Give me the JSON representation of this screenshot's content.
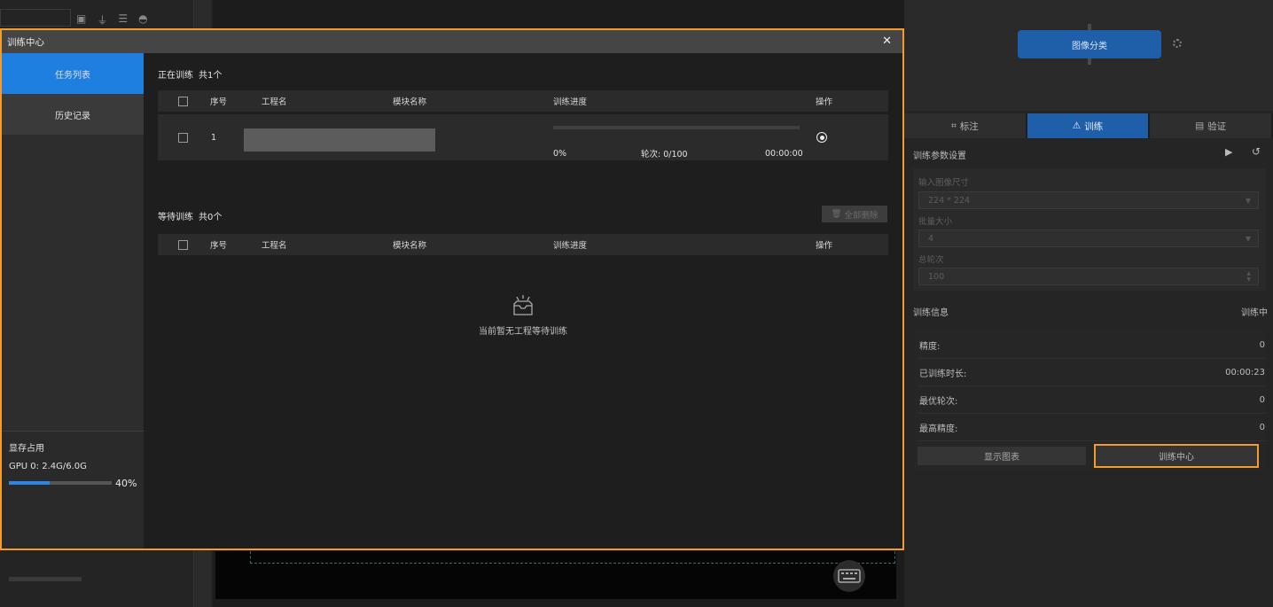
{
  "dialog": {
    "title": "训练中心",
    "close_glyph": "✕",
    "sidebar": {
      "tasks_label": "任务列表",
      "history_label": "历史记录",
      "vram_title": "显存占用",
      "gpu_text": "GPU 0: 2.4G/6.0G",
      "vram_progress": 0.4,
      "vram_percent": "40%"
    },
    "training": {
      "title": "正在训练",
      "count": "共1个",
      "columns": [
        "序号",
        "工程名",
        "模块名称",
        "训练进度",
        "操作"
      ],
      "rows": [
        {
          "index": "1",
          "project_name": "",
          "module_name": "",
          "progress_pct": "0%",
          "epoch_text": "轮次: 0/100",
          "elapsed": "00:00:00",
          "progress_value": 0
        }
      ]
    },
    "waiting": {
      "title": "等待训练",
      "count": "共0个",
      "delete_all_label": "全部删除",
      "columns": [
        "序号",
        "工程名",
        "模块名称",
        "训练进度",
        "操作"
      ],
      "empty_text": "当前暂无工程等待训练"
    }
  },
  "right_panel": {
    "node_label": "图像分类",
    "tabs": [
      {
        "label": "标注",
        "icon": "annotate-icon"
      },
      {
        "label": "训练",
        "icon": "train-icon",
        "active": true
      },
      {
        "label": "验证",
        "icon": "validate-icon"
      }
    ],
    "params": {
      "title": "训练参数设置",
      "input_size_label": "输入图像尺寸",
      "input_size_value": "224 * 224",
      "batch_size_label": "批量大小",
      "batch_size_value": "4",
      "epochs_label": "总轮次",
      "epochs_value": "100"
    },
    "info": {
      "title": "训练信息",
      "status": "训练中",
      "rows": [
        {
          "label": "精度:",
          "value": "0"
        },
        {
          "label": "已训练时长:",
          "value": "00:00:23"
        },
        {
          "label": "最优轮次:",
          "value": "0"
        },
        {
          "label": "最高精度:",
          "value": "0"
        }
      ],
      "show_chart_label": "显示图表",
      "train_center_label": "训练中心"
    }
  },
  "colors": {
    "accent_orange": "#f39c2b",
    "primary_blue": "#1f7fe0",
    "tab_blue": "#1f5ea8"
  }
}
